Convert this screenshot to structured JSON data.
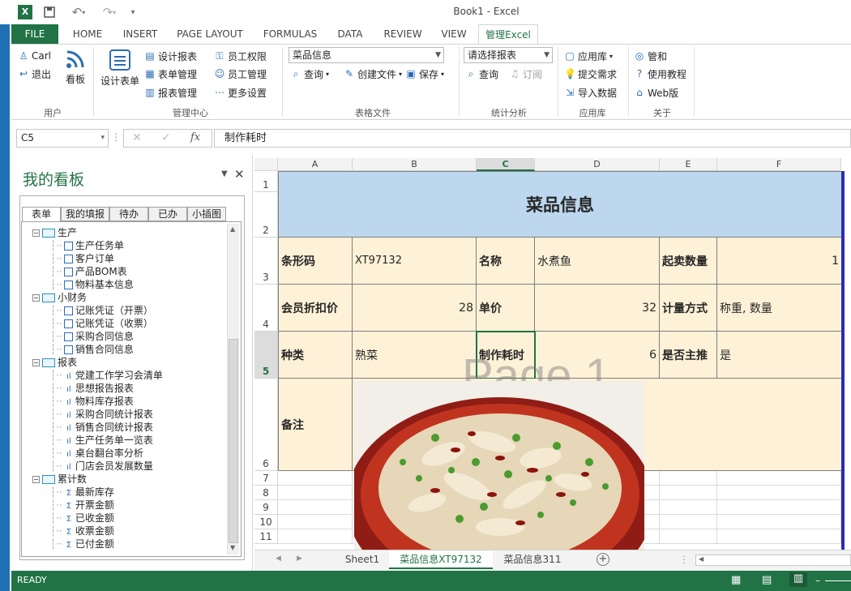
{
  "window": {
    "title": "Book1 - Excel"
  },
  "tabs": [
    {
      "label": "FILE"
    },
    {
      "label": "HOME"
    },
    {
      "label": "INSERT"
    },
    {
      "label": "PAGE LAYOUT"
    },
    {
      "label": "FORMULAS"
    },
    {
      "label": "DATA"
    },
    {
      "label": "REVIEW"
    },
    {
      "label": "VIEW"
    },
    {
      "label": "管理Excel"
    }
  ],
  "ribbon": {
    "user_group": {
      "user": "Carl",
      "logout": "退出",
      "board": "看板",
      "label": "用户"
    },
    "mgmt_group": {
      "design_form": "设计表单",
      "design_report": "设计报表",
      "form_mgmt": "表单管理",
      "report_mgmt": "报表管理",
      "emp_perm": "员工权限",
      "emp_mgmt": "员工管理",
      "more_settings": "更多设置",
      "label": "管理中心"
    },
    "table_group": {
      "select": "菜品信息",
      "query": "查询",
      "create": "创建文件",
      "save": "保存",
      "label": "表格文件"
    },
    "stats_group": {
      "select": "请选择报表",
      "query": "查询",
      "subscribe": "订阅",
      "label": "统计分析"
    },
    "app_group": {
      "store": "应用库",
      "submit": "提交需求",
      "import": "导入数据",
      "label": "应用库"
    },
    "about_group": {
      "home": "管和",
      "tutorial": "使用教程",
      "web": "Web版",
      "label": "关于"
    }
  },
  "formula_bar": {
    "name_box": "C5",
    "fx": "fx",
    "content": "制作耗时"
  },
  "panel": {
    "title": "我的看板",
    "tabs": [
      "表单",
      "我的填报",
      "待办",
      "已办",
      "小插图"
    ],
    "tree": [
      {
        "label": "生产",
        "children": [
          "生产任务单",
          "客户订单",
          "产品BOM表",
          "物料基本信息"
        ]
      },
      {
        "label": "小财务",
        "children": [
          "记账凭证（开票）",
          "记账凭证（收票）",
          "采购合同信息",
          "销售合同信息"
        ]
      },
      {
        "label": "报表",
        "children": [
          "党建工作学习会清单",
          "思想报告报表",
          "物料库存报表",
          "采购合同统计报表",
          "销售合同统计报表",
          "生产任务单一览表",
          "桌台翻台率分析",
          "门店会员发展数量"
        ]
      },
      {
        "label": "累计数",
        "children": [
          "最新库存",
          "开票金额",
          "已收金额",
          "收票金额",
          "已付金额"
        ]
      }
    ]
  },
  "sheet": {
    "columns": [
      "A",
      "B",
      "C",
      "D",
      "E",
      "F"
    ],
    "rows": [
      "1",
      "2",
      "3",
      "4",
      "5",
      "6",
      "7",
      "8",
      "9",
      "10",
      "11"
    ],
    "title": "菜品信息",
    "watermark": "Page 1",
    "fields": {
      "barcode_label": "条形码",
      "barcode": "XT97132",
      "name_label": "名称",
      "name": "水煮鱼",
      "min_qty_label": "起卖数量",
      "min_qty": "1",
      "discount_label": "会员折扣价",
      "discount": "28",
      "price_label": "单价",
      "price": "32",
      "measure_label": "计量方式",
      "measure": "称重, 数量",
      "type_label": "种类",
      "type": "熟菜",
      "time_label": "制作耗时",
      "time": "6",
      "main_label": "是否主推",
      "main": "是",
      "note_label": "备注"
    },
    "tabs": [
      "Sheet1",
      "菜品信息XT97132",
      "菜品信息311"
    ]
  },
  "status": {
    "ready": "READY"
  }
}
